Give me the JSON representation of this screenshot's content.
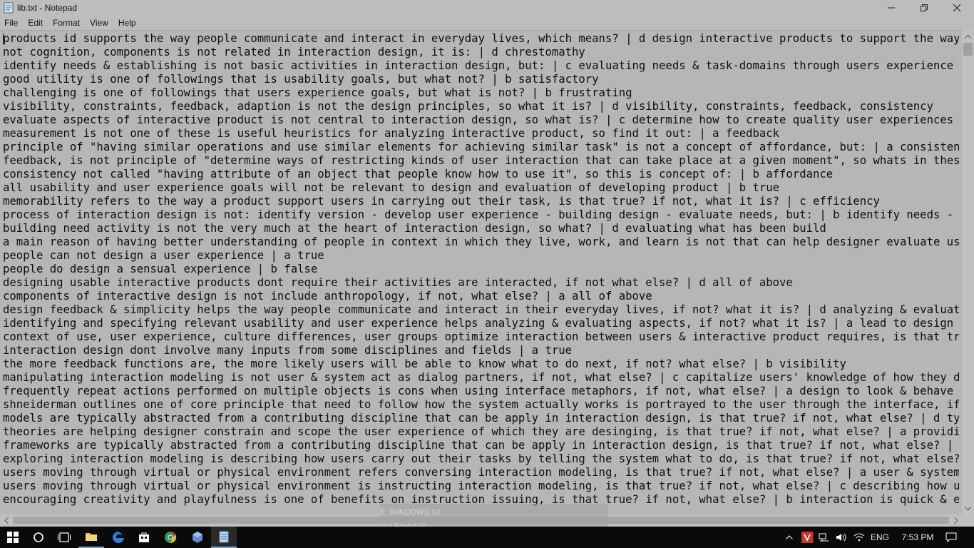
{
  "window": {
    "title": "lib.txt - Notepad"
  },
  "menu": [
    "File",
    "Edit",
    "Format",
    "View",
    "Help"
  ],
  "editor": {
    "lines": [
      "products id supports the way people communicate and interact in everyday lives, which means? | d design interactive products to support the way peopl",
      "not cognition, components is not related in interaction design, it is: | d chrestomathy",
      "identify needs & establishing is not basic activities in interaction design, but: | c evaluating needs & task-domains through users experience",
      "good utility is one of followings that is usability goals, but what not? | b satisfactory",
      "challenging is one of followings that users experience goals, but what is not? | b frustrating",
      "visibility, constraints, feedback, adaption is not the design principles, so what it is? | d visibility, constraints, feedback, consistency",
      "evaluate aspects of interactive product is not central to interaction design, so what is? | c determine how to create quality user experiences",
      "measurement is not one of these is useful heuristics for analyzing interactive product, so find it out: | a feedback",
      "principle of \"having similar operations and use similar elements for achieving similar task\" is not a concept of affordance, but: | a consistency",
      "feedback, is not principle of \"determine ways of restricting kinds of user interaction that can take place at a given moment\", so whats in these? | c",
      "consistency not called \"having attribute of an object that people know how to use it\", so this is concept of: | b affordance",
      "all usability and user experience goals will not be relevant to design and evaluation of developing product | b true",
      "memorability refers to the way a product support users in carrying out their task, is that true? if not, what it is? | c efficiency",
      "process of interaction design is not: identify version - develop user experience - building design - evaluate needs, but: | b identify needs - develo",
      "building need activity is not the very much at the heart of interaction design, so what? | d evaluating what has been build",
      "a main reason of having better understanding of people in context in which they live, work, and learn is not that can help designer evaluate user exp",
      "people can not design a user experience | a true",
      "people do design a sensual experience | b false",
      "designing usable interactive products dont require their activities are interacted, if not what else? | d all of above",
      "components of interactive design is not include anthropology, if not, what else? | a all of above",
      "design feedback & simplicity helps the way people communicate and interact in their everyday lives, if not? what it is? | d analyzing & evaluating as",
      "identifying and specifying relevant usability and user experience helps analyzing & evaluating aspects, if not? what it is? | a lead to design of goo",
      "context of use, user experience, culture differences, user groups optimize interaction between users & interactive product requires, is that true? if",
      "interaction design dont involve many inputs from some disciplines and fields | a true",
      "the more feedback functions are, the more likely users will be able to know what to do next, if not? what else? | b visibility",
      "manipulating interaction modeling is not user & system act as dialog partners, if not, what else? | c capitalize users' knowledge of how they do in p",
      "frequently repeat actions performed on multiple objects is cons when using interface metaphors, if not, what else? | a design to look & behave litera",
      "shneiderman outlines one of core principle that need to follow how the system actually works is portrayed to the user through the interface, if not,",
      "models are typically abstracted from a contributing discipline that can be apply in interaction design, is that true? if not, what else? | d typicall",
      "theories are helping designer constrain and scope the user experience of which they are desinging, is that true? if not, what else? | a providing of",
      "frameworks are typically abstracted from a contributing discipline that can be apply in interaction design, is that true? if not, what else? | b help",
      "exploring interaction modeling is describing how users carry out their tasks by telling the system what to do, is that true? if not, what else? | d u",
      "users moving through virtual or physical environment refers conversing interaction modeling, is that true? if not, what else? | a user & system act a",
      "users moving through virtual or physical environment is instructing interaction modeling, is that true? if not, what else? | c describing how users c",
      "encouraging creativity and playfulness is one of benefits on instruction issuing, is that true? if not, what else? | b interaction is quick & efficie"
    ]
  },
  "notification": {
    "line1": "E: WINDOWS 10",
    "line2": "Not Found.!!!"
  },
  "taskbar": {
    "language": "ENG",
    "time": "7:53 PM",
    "pinned": [
      "windows-start-icon",
      "cortana-search-icon",
      "task-view-icon",
      "file-explorer-icon",
      "edge-browser-icon",
      "store-icon",
      "chrome-icon",
      "virtualbox-icon",
      "notepad-icon"
    ]
  },
  "colors": {
    "taskbar": "#0a0a0a",
    "editor_bg": "#b6b6b6",
    "titlebar": "#bdbdbd"
  }
}
